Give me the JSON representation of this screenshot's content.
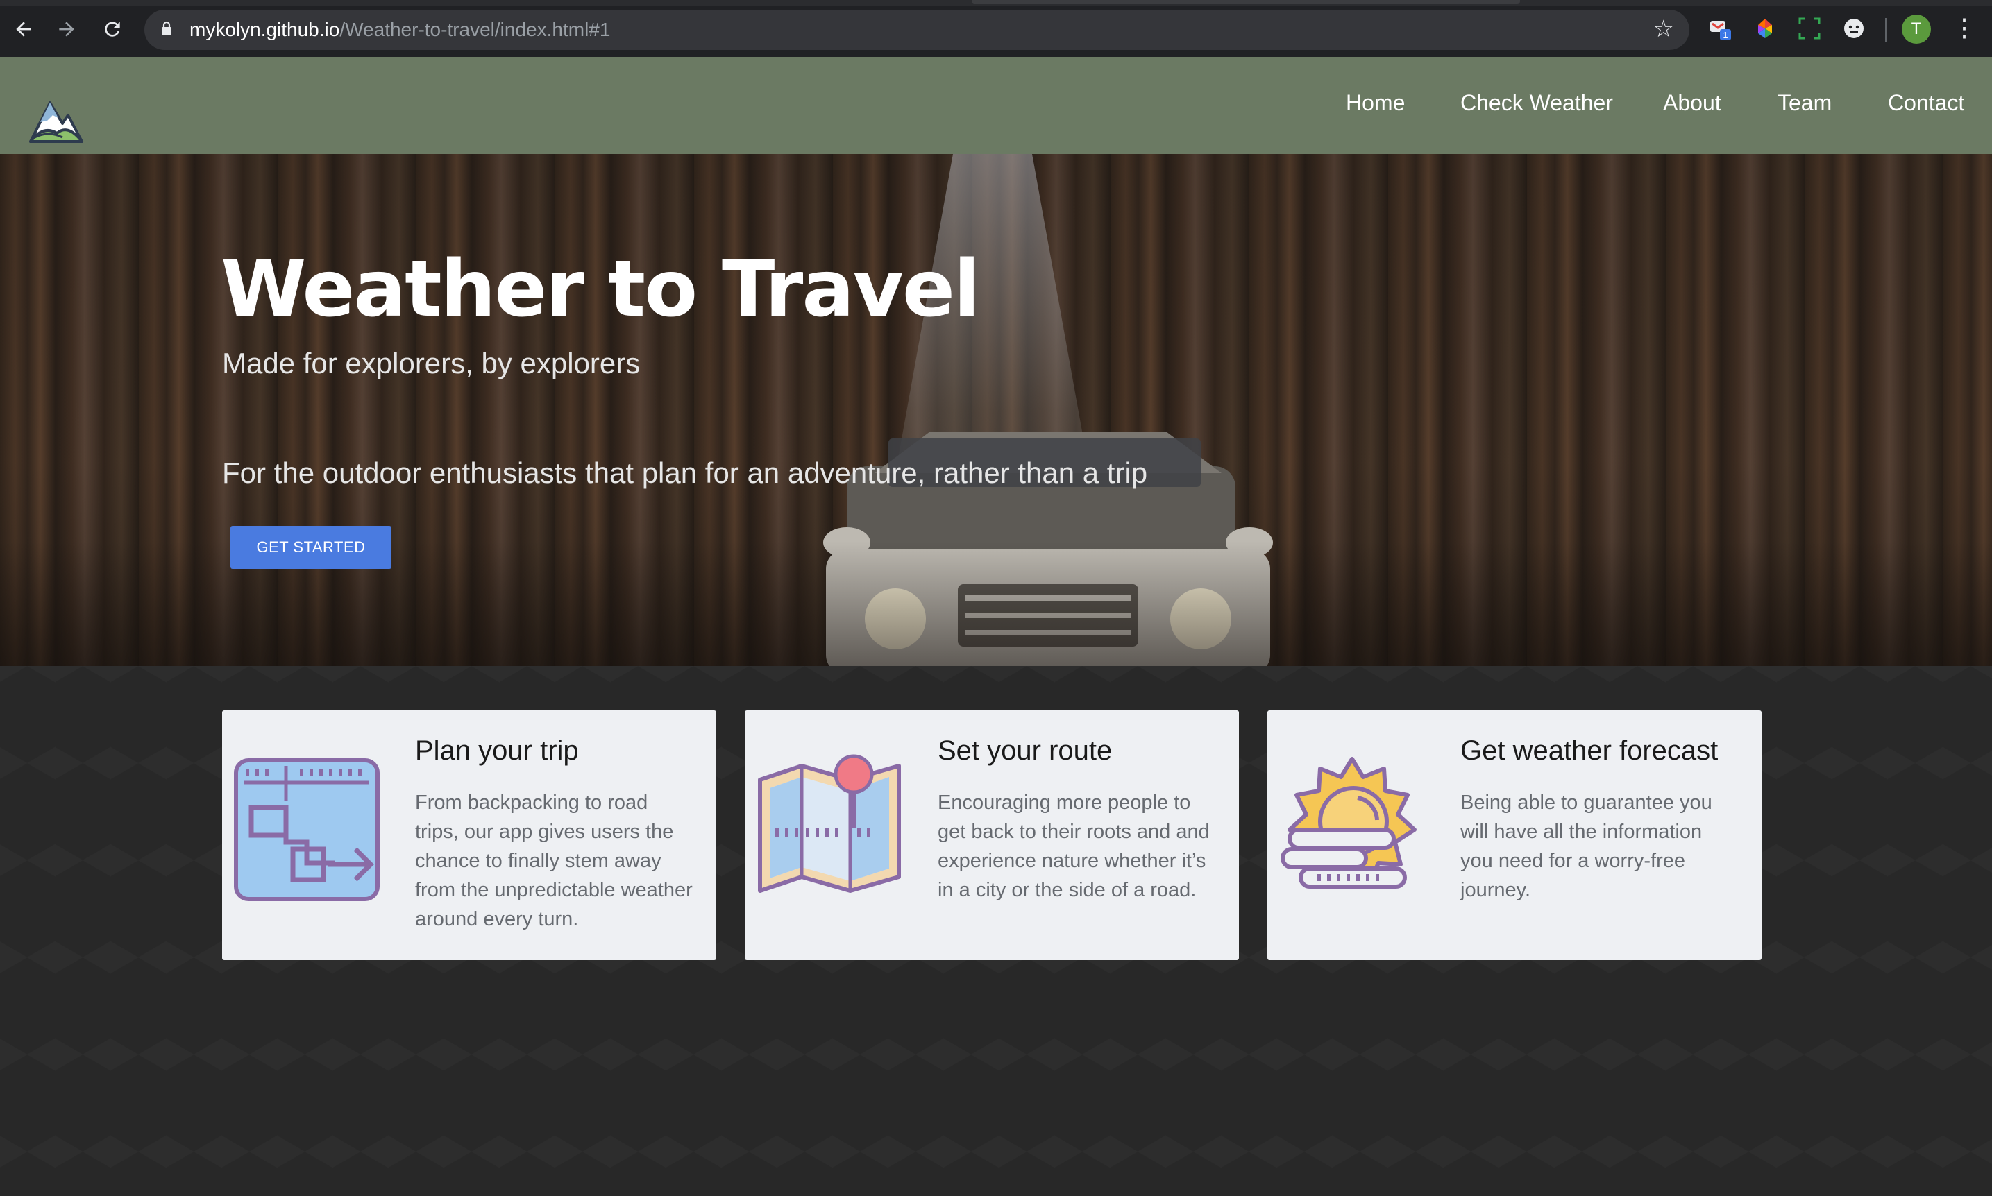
{
  "browser": {
    "url_host": "mykolyn.github.io",
    "url_path": "/Weather-to-travel/index.html#1",
    "profile_initial": "T",
    "extension_badge": "1",
    "icons": [
      "back-arrow-icon",
      "forward-arrow-icon",
      "reload-icon",
      "lock-icon",
      "bookmark-star-icon",
      "extension-icons",
      "kebab-menu-icon"
    ]
  },
  "header": {
    "nav": [
      "Home",
      "Check Weather",
      "About",
      "Team",
      "Contact"
    ],
    "colors": {
      "bar": "#6b7a63"
    }
  },
  "hero": {
    "title": "Weather to Travel",
    "subtitle": "Made for explorers, by explorers",
    "tagline": "For the outdoor enthusiasts that plan for an adventure, rather than a trip",
    "cta_label": "GET STARTED",
    "colors": {
      "cta": "#4a7be0"
    }
  },
  "features": [
    {
      "icon": "map-grid-icon",
      "title": "Plan your trip",
      "text": "From backpacking to road trips, our app gives users the chance to finally stem away from the unpredictable weather around every turn."
    },
    {
      "icon": "folded-map-pin-icon",
      "title": "Set your route",
      "text": "Encouraging more people to get back to their roots and and experience nature whether it’s in a city or the side of a road."
    },
    {
      "icon": "sun-cloud-icon",
      "title": "Get weather forecast",
      "text": "Being able to guarantee you will have all the information you need for a worry-free journey."
    }
  ]
}
